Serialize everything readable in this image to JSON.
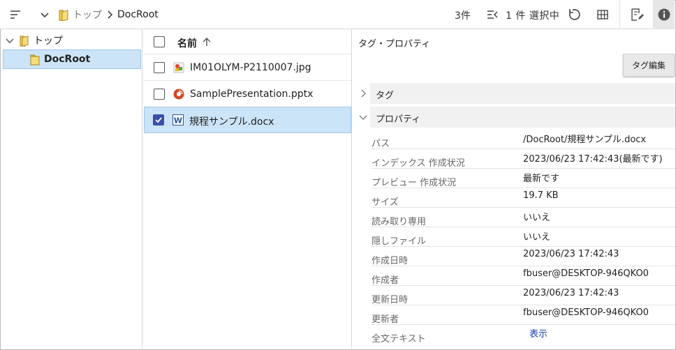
{
  "toolbar": {
    "breadcrumb_top": "トップ",
    "breadcrumb_current": "DocRoot",
    "count": "3件",
    "selection": "1 件 選択中",
    "icons": [
      "menu-icon",
      "chevron-down-icon",
      "folder-icon",
      "chevron-right-icon",
      "select-list-icon",
      "refresh-icon",
      "grid-icon",
      "edit-doc-icon",
      "info-icon"
    ]
  },
  "tree": {
    "items": [
      {
        "label": "トップ",
        "expanded": true
      },
      {
        "label": "DocRoot",
        "selected": true
      }
    ]
  },
  "list": {
    "header_label": "名前",
    "files": [
      {
        "name": "IM01OLYM-P2110007.jpg",
        "icon": "image-file-icon",
        "checked": false
      },
      {
        "name": "SamplePresentation.pptx",
        "icon": "powerpoint-file-icon",
        "checked": false
      },
      {
        "name": "規程サンプル.docx",
        "icon": "word-file-icon",
        "checked": true
      }
    ]
  },
  "props": {
    "title": "タグ・プロパティ",
    "tag_edit_button": "タグ編集",
    "section_tags": "タグ",
    "section_props": "プロパティ",
    "rows": [
      {
        "key": "パス",
        "value": "/DocRoot/規程サンプル.docx"
      },
      {
        "key": "インデックス 作成状況",
        "value": "2023/06/23 17:42:43(最新です)"
      },
      {
        "key": "プレビュー 作成状況",
        "value": "最新です"
      },
      {
        "key": "サイズ",
        "value": "19.7 KB"
      },
      {
        "key": "読み取り専用",
        "value": "いいえ"
      },
      {
        "key": "隠しファイル",
        "value": "いいえ"
      },
      {
        "key": "作成日時",
        "value": "2023/06/23 17:42:43"
      },
      {
        "key": "作成者",
        "value": "fbuser@DESKTOP-946QKO0"
      },
      {
        "key": "更新日時",
        "value": "2023/06/23 17:42:43"
      },
      {
        "key": "更新者",
        "value": "fbuser@DESKTOP-946QKO0"
      }
    ],
    "fulltext_key": "全文テキスト",
    "fulltext_link": "表示"
  },
  "colors": {
    "selection_bg": "#cce4f7",
    "checkbox_checked": "#3c4fa6",
    "folder_yellow": "#f2c94c",
    "link_blue": "#1a3fb0"
  }
}
